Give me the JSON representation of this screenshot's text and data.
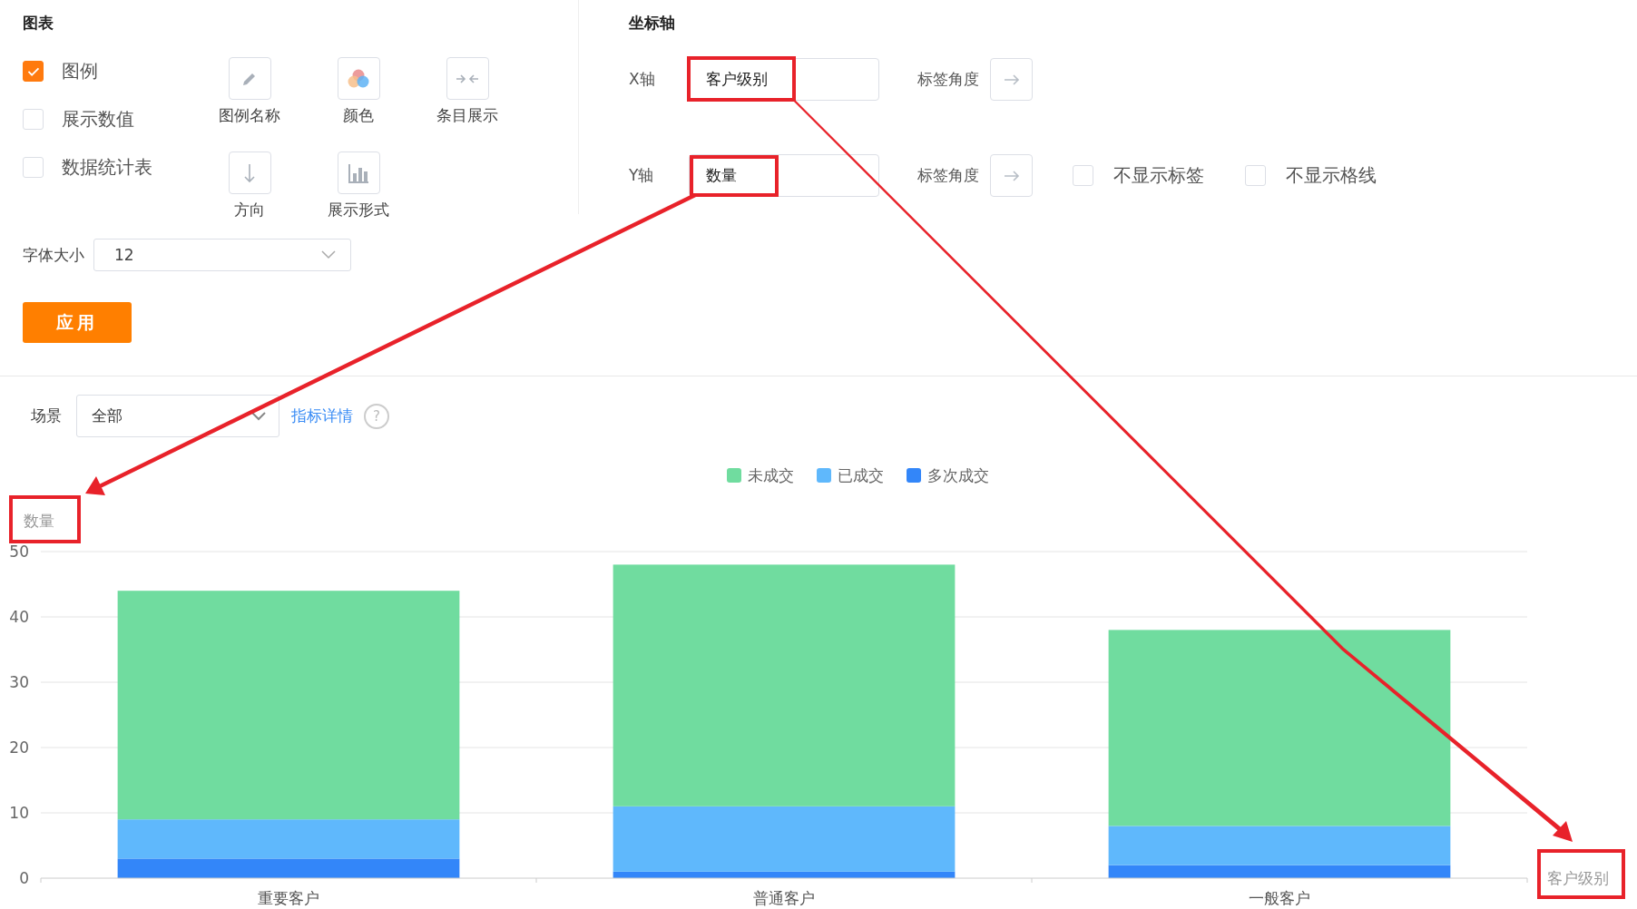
{
  "chart_settings": {
    "title": "图表",
    "options": [
      {
        "label": "图例",
        "checked": true
      },
      {
        "label": "展示数值",
        "checked": false
      },
      {
        "label": "数据统计表",
        "checked": false
      }
    ],
    "tools": [
      {
        "label": "图例名称",
        "kind": "pencil"
      },
      {
        "label": "颜色",
        "kind": "colors"
      },
      {
        "label": "条目展示",
        "kind": "compress"
      },
      {
        "label": "方向",
        "kind": "down"
      },
      {
        "label": "展示形式",
        "kind": "bars"
      }
    ],
    "font_size": {
      "label": "字体大小",
      "value": "12"
    },
    "apply_button": "应用"
  },
  "axis_settings": {
    "title": "坐标轴",
    "rows": [
      {
        "axis": "X轴",
        "value": "客户级别",
        "angle_label": "标签角度",
        "options": []
      },
      {
        "axis": "Y轴",
        "value": "数量",
        "angle_label": "标签角度",
        "options": [
          {
            "label": "不显示标签",
            "checked": false
          },
          {
            "label": "不显示格线",
            "checked": false
          }
        ]
      }
    ]
  },
  "filter": {
    "label": "场景",
    "value": "全部",
    "link": "指标详情",
    "help": "?"
  },
  "chart_data": {
    "type": "bar",
    "stacked": true,
    "xlabel": "客户级别",
    "ylabel": "数量",
    "categories": [
      "重要客户",
      "普通客户",
      "一般客户"
    ],
    "series": [
      {
        "name": "未成交",
        "color": "#70dc9f",
        "values": [
          35,
          37,
          30
        ]
      },
      {
        "name": "已成交",
        "color": "#5fb8fc",
        "values": [
          6,
          10,
          6
        ]
      },
      {
        "name": "多次成交",
        "color": "#3386f9",
        "values": [
          3,
          1,
          2
        ]
      }
    ],
    "grid": true,
    "legend": true,
    "ylim": [
      0,
      50
    ],
    "yticks": [
      0,
      10,
      20,
      30,
      40,
      50
    ]
  }
}
